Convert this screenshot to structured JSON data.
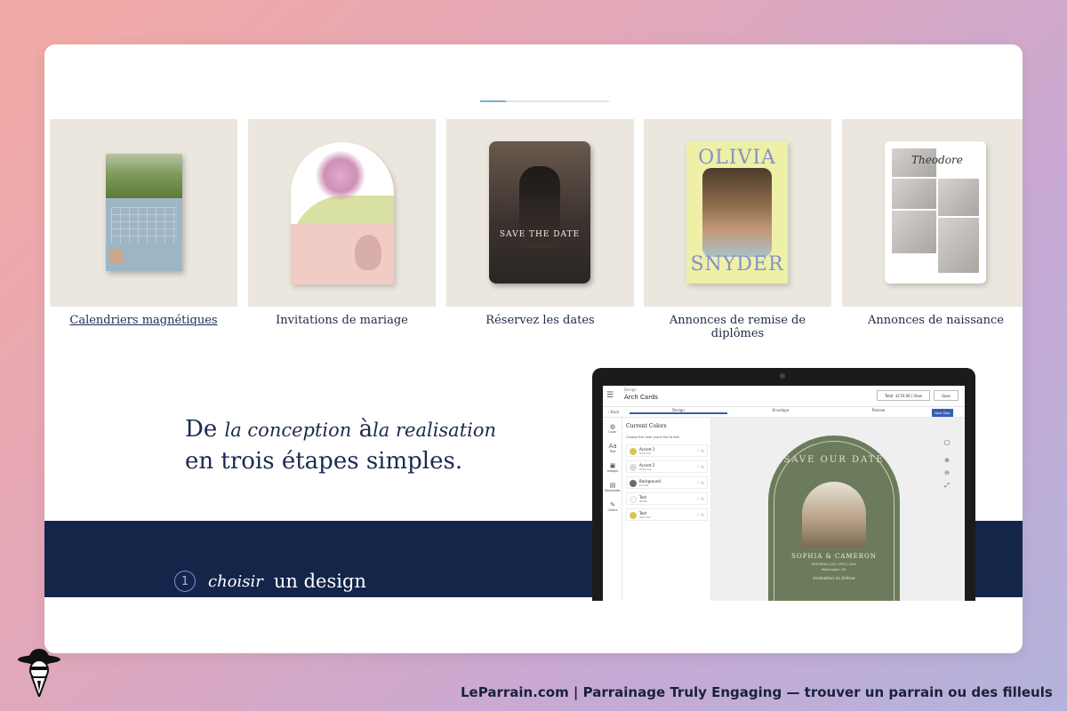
{
  "carousel": {
    "progress": 0.2,
    "items": [
      {
        "label": "Calendriers magnétiques",
        "active": true
      },
      {
        "label": "Invitations de mariage"
      },
      {
        "label": "Réservez les dates",
        "card_text": "SAVE THE DATE"
      },
      {
        "label": "Annonces de remise de diplômes",
        "card_text_top": "OLIVIA",
        "card_text_bottom": "SNYDER"
      },
      {
        "label": "Annonces de naissance",
        "card_text": "Theodore"
      }
    ]
  },
  "intro": {
    "line1_prefix": "De",
    "line1_script_a": "la conception",
    "line1_mid": "à",
    "line1_script_b": "la realisation",
    "line2": "en trois étapes simples."
  },
  "step": {
    "number": "1",
    "script": "choisir",
    "text": "un design"
  },
  "editor": {
    "subtitle": "Design",
    "title": "Arch Cards",
    "total": "Total: $170.00",
    "view": "View",
    "save": "Save",
    "back": "‹ Back",
    "tabs": [
      "Design",
      "Envelope",
      "Review"
    ],
    "next": "Next Step",
    "rail": [
      "Color",
      "Text",
      "Images",
      "Backsides",
      "Colors"
    ],
    "panel_title": "Current Colors",
    "panel_desc": "Choose the color you'd like to edit.",
    "colors": [
      {
        "name": "Accent 1",
        "sub": "Gold Foil",
        "hex": "#d8c25a"
      },
      {
        "name": "Accent 2",
        "sub": "Pinecone",
        "hex": "#dcdcd8"
      },
      {
        "name": "Background",
        "sub": "Cactus",
        "hex": "#6b7b5c"
      },
      {
        "name": "Text",
        "sub": "White",
        "hex": "#f7f7f7"
      },
      {
        "name": "Text",
        "sub": "Gold Foil",
        "hex": "#d8c25a"
      }
    ],
    "card": {
      "title": "SAVE OUR DATE",
      "names": "SOPHIA & CAMERON",
      "date": "SATURDAY, JULY 24TH | 2024",
      "place": "Washington, DC",
      "script": "invitation to follow"
    }
  },
  "footer": {
    "text": "LeParrain.com | Parrainage Truly Engaging — trouver un parrain ou des filleuls"
  },
  "colors": {
    "navy": "#14254a",
    "accent": "#7a8ed8",
    "progress": "#7aaed0"
  }
}
